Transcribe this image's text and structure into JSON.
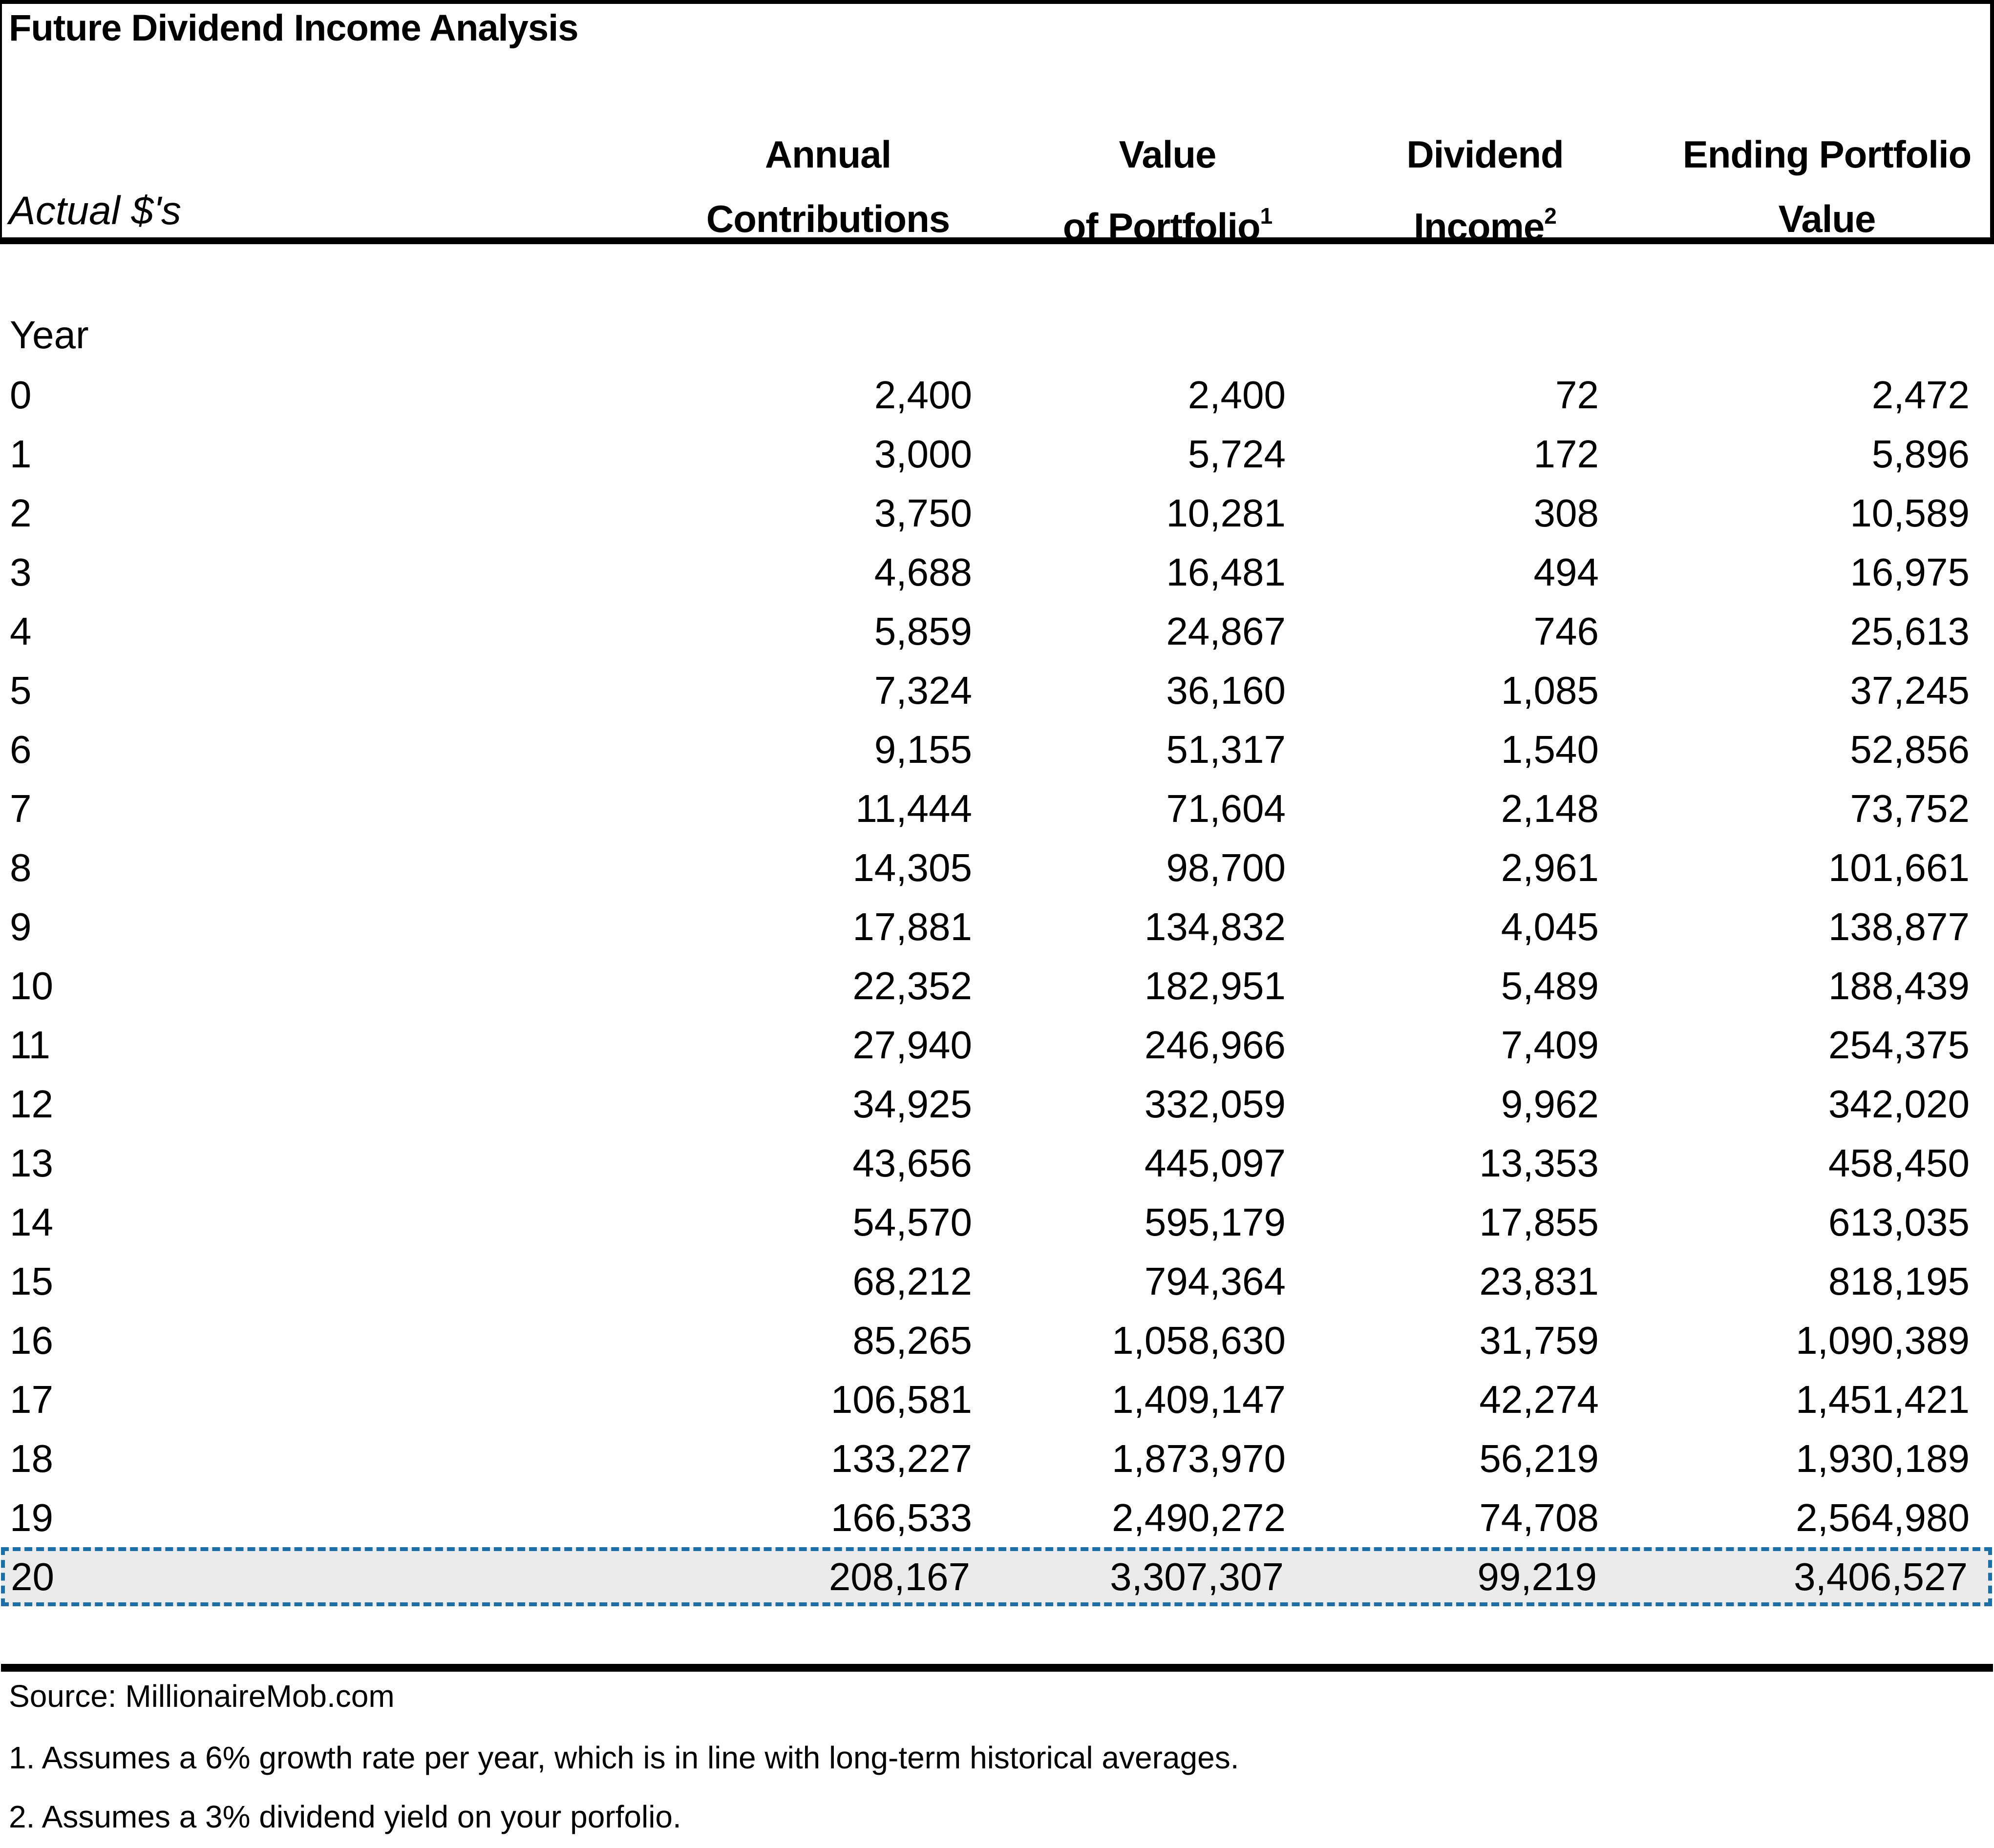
{
  "title": "Future Dividend Income Analysis",
  "subtitle": "Actual $'s",
  "columns": [
    {
      "line1": "Annual",
      "line2": "Contributions",
      "footnote": ""
    },
    {
      "line1": "Value",
      "line2": "of Portfolio",
      "footnote": "1"
    },
    {
      "line1": "Dividend",
      "line2": "Income",
      "footnote": "2"
    },
    {
      "line1": "Ending Portfolio",
      "line2": "Value",
      "footnote": ""
    }
  ],
  "row_header": "Year",
  "highlight_color": "#1b6fa8",
  "highlight_fill": "#ebebeb",
  "rows": [
    {
      "year": "0",
      "contrib": "2,400",
      "value": "2,400",
      "dividend": "72",
      "ending": "2,472"
    },
    {
      "year": "1",
      "contrib": "3,000",
      "value": "5,724",
      "dividend": "172",
      "ending": "5,896"
    },
    {
      "year": "2",
      "contrib": "3,750",
      "value": "10,281",
      "dividend": "308",
      "ending": "10,589"
    },
    {
      "year": "3",
      "contrib": "4,688",
      "value": "16,481",
      "dividend": "494",
      "ending": "16,975"
    },
    {
      "year": "4",
      "contrib": "5,859",
      "value": "24,867",
      "dividend": "746",
      "ending": "25,613"
    },
    {
      "year": "5",
      "contrib": "7,324",
      "value": "36,160",
      "dividend": "1,085",
      "ending": "37,245"
    },
    {
      "year": "6",
      "contrib": "9,155",
      "value": "51,317",
      "dividend": "1,540",
      "ending": "52,856"
    },
    {
      "year": "7",
      "contrib": "11,444",
      "value": "71,604",
      "dividend": "2,148",
      "ending": "73,752"
    },
    {
      "year": "8",
      "contrib": "14,305",
      "value": "98,700",
      "dividend": "2,961",
      "ending": "101,661"
    },
    {
      "year": "9",
      "contrib": "17,881",
      "value": "134,832",
      "dividend": "4,045",
      "ending": "138,877"
    },
    {
      "year": "10",
      "contrib": "22,352",
      "value": "182,951",
      "dividend": "5,489",
      "ending": "188,439"
    },
    {
      "year": "11",
      "contrib": "27,940",
      "value": "246,966",
      "dividend": "7,409",
      "ending": "254,375"
    },
    {
      "year": "12",
      "contrib": "34,925",
      "value": "332,059",
      "dividend": "9,962",
      "ending": "342,020"
    },
    {
      "year": "13",
      "contrib": "43,656",
      "value": "445,097",
      "dividend": "13,353",
      "ending": "458,450"
    },
    {
      "year": "14",
      "contrib": "54,570",
      "value": "595,179",
      "dividend": "17,855",
      "ending": "613,035"
    },
    {
      "year": "15",
      "contrib": "68,212",
      "value": "794,364",
      "dividend": "23,831",
      "ending": "818,195"
    },
    {
      "year": "16",
      "contrib": "85,265",
      "value": "1,058,630",
      "dividend": "31,759",
      "ending": "1,090,389"
    },
    {
      "year": "17",
      "contrib": "106,581",
      "value": "1,409,147",
      "dividend": "42,274",
      "ending": "1,451,421"
    },
    {
      "year": "18",
      "contrib": "133,227",
      "value": "1,873,970",
      "dividend": "56,219",
      "ending": "1,930,189"
    },
    {
      "year": "19",
      "contrib": "166,533",
      "value": "2,490,272",
      "dividend": "74,708",
      "ending": "2,564,980"
    },
    {
      "year": "20",
      "contrib": "208,167",
      "value": "3,307,307",
      "dividend": "99,219",
      "ending": "3,406,527",
      "selected": true
    }
  ],
  "footer": {
    "source": "Source: MillionaireMob.com",
    "note1": "1. Assumes a 6% growth rate per year, which is in line with long-term historical averages.",
    "note2": "2. Assumes a 3% dividend yield on your porfolio."
  }
}
